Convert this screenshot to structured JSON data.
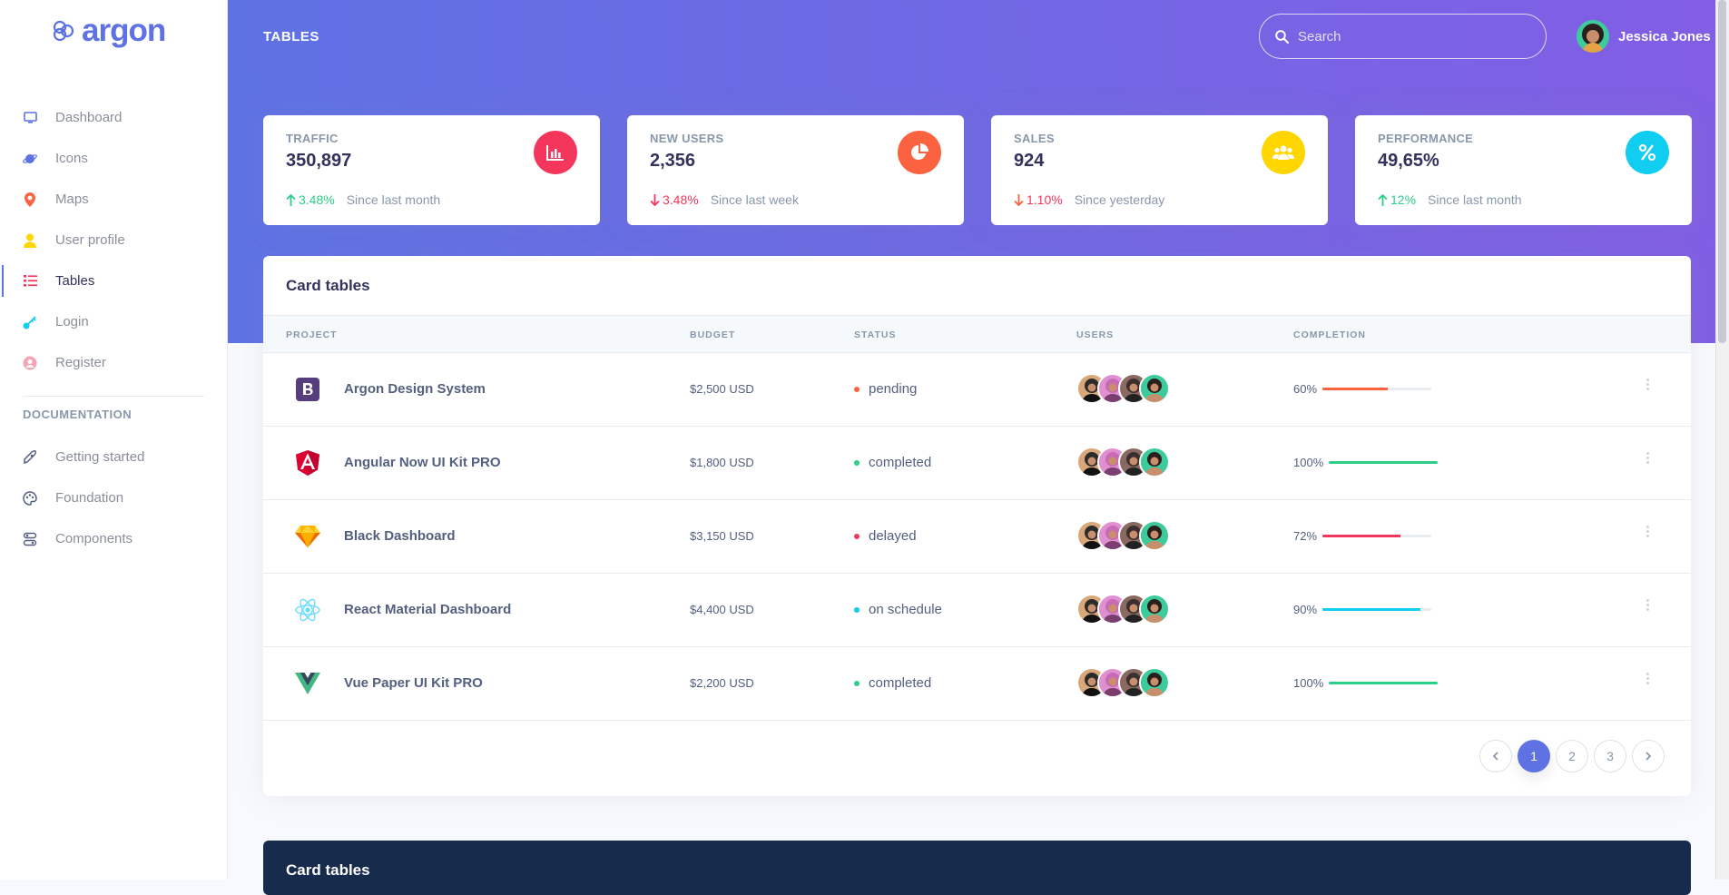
{
  "brand": {
    "name": "argon"
  },
  "sidebar": {
    "items": [
      {
        "label": "Dashboard",
        "icon": "tv-icon",
        "color": "#5e72e4"
      },
      {
        "label": "Icons",
        "icon": "planet-icon",
        "color": "#5e72e4"
      },
      {
        "label": "Maps",
        "icon": "pin-icon",
        "color": "#fb6340"
      },
      {
        "label": "User profile",
        "icon": "user-icon",
        "color": "#ffd600"
      },
      {
        "label": "Tables",
        "icon": "list-icon",
        "color": "#f5365c",
        "active": true
      },
      {
        "label": "Login",
        "icon": "key-icon",
        "color": "#11cdef"
      },
      {
        "label": "Register",
        "icon": "circle-user-icon",
        "color": "#f3a4b5"
      }
    ],
    "doc_heading": "DOCUMENTATION",
    "doc_items": [
      {
        "label": "Getting started",
        "icon": "spaceship-icon"
      },
      {
        "label": "Foundation",
        "icon": "palette-icon"
      },
      {
        "label": "Components",
        "icon": "ui-icon"
      }
    ]
  },
  "header": {
    "title": "TABLES",
    "search_placeholder": "Search",
    "user_name": "Jessica Jones"
  },
  "stats": [
    {
      "label": "TRAFFIC",
      "value": "350,897",
      "change": "3.48%",
      "direction": "up",
      "since": "Since last month",
      "icon": "bar-chart-icon",
      "color": "#f5365c"
    },
    {
      "label": "NEW USERS",
      "value": "2,356",
      "change": "3.48%",
      "direction": "down",
      "since": "Since last week",
      "icon": "pie-chart-icon",
      "color": "#fb6340"
    },
    {
      "label": "SALES",
      "value": "924",
      "change": "1.10%",
      "direction": "down",
      "since": "Since yesterday",
      "icon": "users-icon",
      "color": "#ffd600"
    },
    {
      "label": "PERFORMANCE",
      "value": "49,65%",
      "change": "12%",
      "direction": "up",
      "since": "Since last month",
      "icon": "percent-icon",
      "color": "#11cdef"
    }
  ],
  "table": {
    "title": "Card tables",
    "columns": [
      "PROJECT",
      "BUDGET",
      "STATUS",
      "USERS",
      "COMPLETION"
    ],
    "rows": [
      {
        "project": "Argon Design System",
        "logo": "bootstrap-icon",
        "budget": "$2,500 USD",
        "status": "pending",
        "status_color": "#fb6340",
        "completion": "60%",
        "progress": 0.6,
        "bar_color": "#fb6340"
      },
      {
        "project": "Angular Now UI Kit PRO",
        "logo": "angular-icon",
        "budget": "$1,800 USD",
        "status": "completed",
        "status_color": "#2dce89",
        "completion": "100%",
        "progress": 1.0,
        "bar_color": "#2dce89"
      },
      {
        "project": "Black Dashboard",
        "logo": "sketch-icon",
        "budget": "$3,150 USD",
        "status": "delayed",
        "status_color": "#f5365c",
        "completion": "72%",
        "progress": 0.72,
        "bar_color": "#f5365c"
      },
      {
        "project": "React Material Dashboard",
        "logo": "react-icon",
        "budget": "$4,400 USD",
        "status": "on schedule",
        "status_color": "#11cdef",
        "completion": "90%",
        "progress": 0.9,
        "bar_color": "#11cdef"
      },
      {
        "project": "Vue Paper UI Kit PRO",
        "logo": "vue-icon",
        "budget": "$2,200 USD",
        "status": "completed",
        "status_color": "#2dce89",
        "completion": "100%",
        "progress": 1.0,
        "bar_color": "#2dce89"
      }
    ],
    "pagination": {
      "pages": [
        "1",
        "2",
        "3"
      ],
      "active": "1"
    }
  },
  "second_table": {
    "title": "Card tables"
  },
  "colors": {
    "primary": "#5e72e4",
    "gradient_end": "#825ee4",
    "dark": "#172b4d",
    "success": "#2dce89",
    "danger": "#f5365c"
  }
}
